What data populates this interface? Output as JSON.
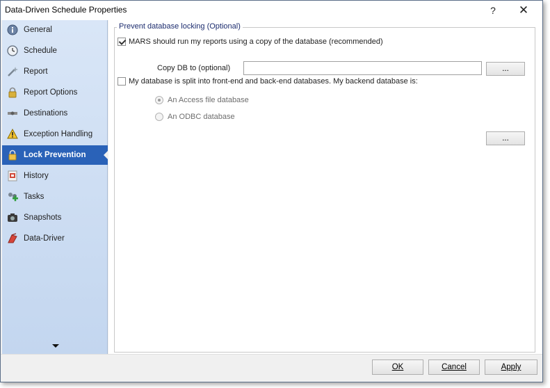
{
  "window": {
    "title": "Data-Driven Schedule Properties",
    "help_label": "?",
    "close_label": "✕"
  },
  "sidebar": {
    "items": [
      {
        "label": "General",
        "icon": "info-icon",
        "color": "#5a6f8c"
      },
      {
        "label": "Schedule",
        "icon": "clock-icon",
        "color": "#6c7684"
      },
      {
        "label": "Report",
        "icon": "wand-icon",
        "color": "#7e8a97"
      },
      {
        "label": "Report Options",
        "icon": "lock-icon",
        "color": "#c9a227"
      },
      {
        "label": "Destinations",
        "icon": "satellite-icon",
        "color": "#8b8b8b"
      },
      {
        "label": "Exception Handling",
        "icon": "warning-icon",
        "color": "#f2c230"
      },
      {
        "label": "Lock Prevention",
        "icon": "lock-icon",
        "color": "#e8b63a",
        "active": true
      },
      {
        "label": "History",
        "icon": "history-icon",
        "color": "#c0392b"
      },
      {
        "label": "Tasks",
        "icon": "tasks-icon",
        "color": "#3a9a3a"
      },
      {
        "label": "Snapshots",
        "icon": "camera-icon",
        "color": "#444444"
      },
      {
        "label": "Data-Driver",
        "icon": "driver-icon",
        "color": "#c0392b"
      }
    ],
    "scroll_down_label": "▼"
  },
  "lock_group": {
    "title": "Prevent database locking (Optional)",
    "copy_option_label": "MARS should run my reports using a copy of the database (recommended)",
    "copy_option_checked": true,
    "copy_to_label": "Copy DB to (optional)",
    "copy_to_value": "",
    "browse_label": "...",
    "split_option_label": "My database is split into front-end and back-end databases. My backend database is:",
    "split_option_checked": false,
    "backend_options": [
      {
        "label": "An Access file database",
        "selected": true
      },
      {
        "label": "An ODBC database",
        "selected": false
      }
    ],
    "backend_browse_label": "..."
  },
  "footer": {
    "ok_label": "OK",
    "cancel_label": "Cancel",
    "apply_label": "Apply"
  }
}
